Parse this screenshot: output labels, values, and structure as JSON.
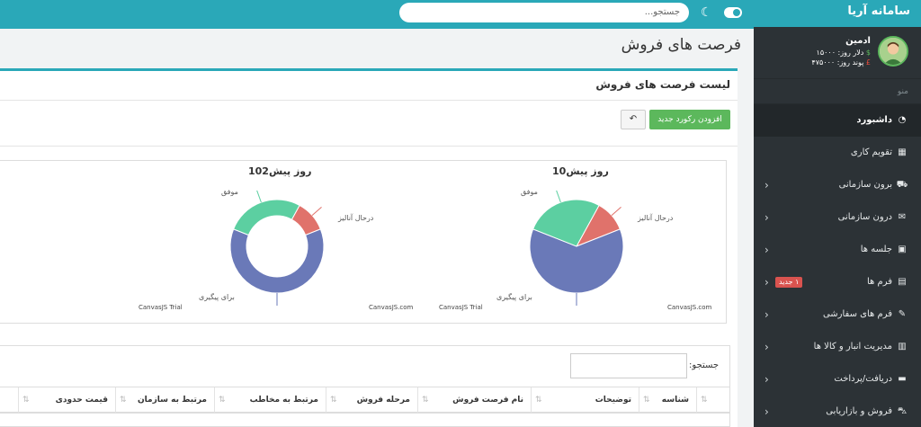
{
  "topbar": {
    "search_placeholder": "جستجو..."
  },
  "sidebar": {
    "brand": "سامانه آریا",
    "user": {
      "name": "ادمین",
      "dollar": "دلار روز: ۱۵۰۰۰",
      "pound": "پوند روز: ۴۷۵۰۰۰"
    },
    "menu_label": "منو",
    "items": [
      {
        "label": "داشبورد",
        "icon": "dashboard-icon",
        "glyph": "◔"
      },
      {
        "label": "تقویم کاری",
        "icon": "calendar-icon",
        "glyph": "▦"
      },
      {
        "label": "برون سازمانی",
        "icon": "truck-icon",
        "glyph": "⛟"
      },
      {
        "label": "درون سازمانی",
        "icon": "envelope-icon",
        "glyph": "✉"
      },
      {
        "label": "جلسه ها",
        "icon": "briefcase-icon",
        "glyph": "▣"
      },
      {
        "label": "فرم ها",
        "icon": "clipboard-icon",
        "glyph": "▤",
        "badge": "۱ جدید"
      },
      {
        "label": "فرم های سفارشی",
        "icon": "edit-icon",
        "glyph": "✎"
      },
      {
        "label": "مدیریت انبار و کالا ها",
        "icon": "boxes-icon",
        "glyph": "▥"
      },
      {
        "label": "دریافت/پرداخت",
        "icon": "money-icon",
        "glyph": "▬"
      },
      {
        "label": "فروش و بازاریابی",
        "icon": "cart-icon",
        "glyph": "⛍"
      }
    ]
  },
  "main": {
    "page_title": "فرصت های فروش",
    "panel_title": "لیست فرصت های فروش",
    "add_button": "افزودن رکورد جدید",
    "tool_button": "↶",
    "search_label": "جستجو:",
    "columns": [
      "شناسه",
      "توضیحات",
      "نام فرصت فروش",
      "مرحله فروش",
      "مرتبط به مخاطب",
      "مرتبط به سازمان",
      "قیمت حدودی"
    ]
  },
  "chart_data": [
    {
      "type": "pie",
      "title": "روز پیش10",
      "credit": "CanvasJS.com",
      "trial": "CanvasJS Trial",
      "series": [
        {
          "name": "درحال آنالیز",
          "value": 11,
          "color": "#e0726b"
        },
        {
          "name": "برای پیگیری",
          "value": 62,
          "color": "#6a79b8"
        },
        {
          "name": "موفق",
          "value": 27,
          "color": "#5ccfa1"
        }
      ]
    },
    {
      "type": "pie",
      "title": "روز پیش102",
      "credit": "CanvasJS.com",
      "trial": "CanvasJS Trial",
      "series": [
        {
          "name": "درحال آنالیز",
          "value": 11,
          "color": "#e0726b"
        },
        {
          "name": "برای پیگیری",
          "value": 62,
          "color": "#6a79b8"
        },
        {
          "name": "موفق",
          "value": 27,
          "color": "#5ccfa1"
        }
      ]
    }
  ]
}
